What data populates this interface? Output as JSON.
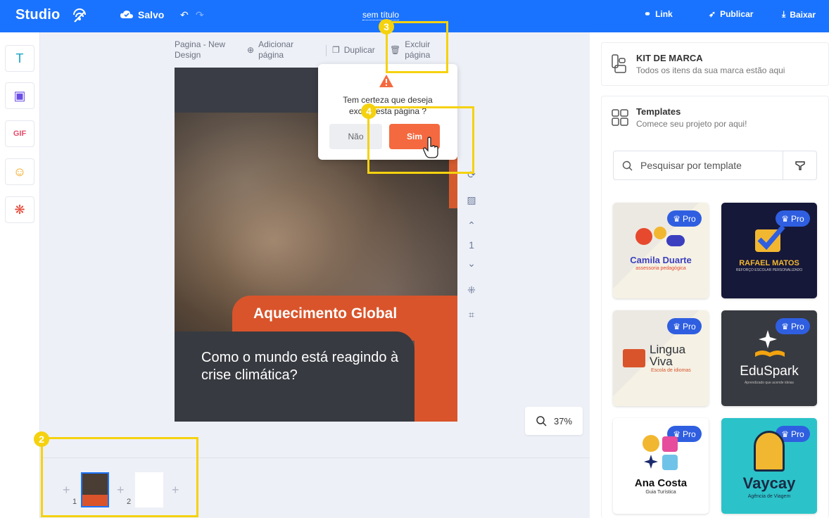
{
  "topbar": {
    "logo": "Studio",
    "saved_label": "Salvo",
    "doc_title": "sem título",
    "link_label": "Link",
    "publish_label": "Publicar",
    "download_label": "Baixar"
  },
  "page_toolbar": {
    "page_name": "Pagina - New Design",
    "add_page": "Adicionar página",
    "duplicate": "Duplicar",
    "delete_page": "Excluir página"
  },
  "design": {
    "title": "Aquecimento Global",
    "subtitle": "Como o mundo  está reagindo à crise climática?"
  },
  "popup": {
    "message": "Tem certeza que deseja excluir esta página ?",
    "no_label": "Não",
    "yes_label": "Sim"
  },
  "side_controls": {
    "page_number": "1"
  },
  "zoom": {
    "level": "37%"
  },
  "pages": {
    "thumb1_number": "1",
    "thumb2_number": "2"
  },
  "right_panel": {
    "brand_kit_title": "KIT DE MARCA",
    "brand_kit_subtitle": "Todos os itens da sua marca estão aqui",
    "templates_title": "Templates",
    "templates_subtitle": "Comece seu projeto por aqui!",
    "search_placeholder": "Pesquisar por template",
    "pro_label": "Pro",
    "templates": [
      {
        "name": "Camila Duarte",
        "tagline": "assessoria pedagógica"
      },
      {
        "name": "RAFAEL MATOS",
        "tagline": "REFORÇO ESCOLAR PERSONALIZADO"
      },
      {
        "name": "Lingua Viva",
        "tagline": "Escola de idiomas"
      },
      {
        "name": "EduSpark",
        "tagline": "Aprendizado que acende ideias"
      },
      {
        "name": "Ana Costa",
        "tagline": "Guia Turística"
      },
      {
        "name": "Vaycay",
        "tagline": "Agência de Viagem"
      }
    ]
  },
  "annotations": {
    "badge2": "2",
    "badge3": "3",
    "badge4": "4"
  },
  "colors": {
    "primary": "#1a73ff",
    "accent_orange": "#f4693f",
    "annotation": "#f5d20f"
  }
}
